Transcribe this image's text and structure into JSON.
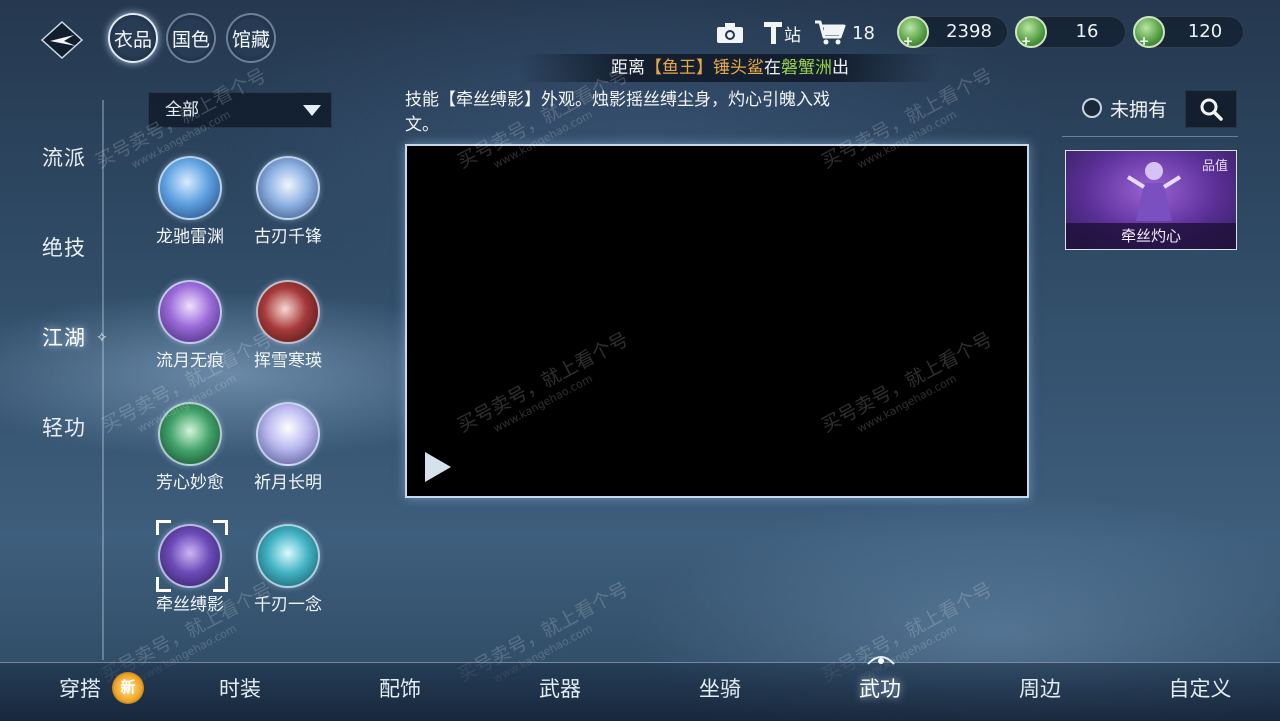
{
  "header": {
    "tabs": [
      {
        "label": "衣品",
        "active": true
      },
      {
        "label": "国色",
        "active": false
      },
      {
        "label": "馆藏",
        "active": false
      }
    ],
    "camera_icon": "camera-icon",
    "station_icon_label": "站",
    "cart_count": "18",
    "currencies": [
      {
        "name": "jade-coin-icon",
        "value": "2398"
      },
      {
        "name": "jade-coin-icon",
        "value": "16"
      },
      {
        "name": "jade-coin-icon",
        "value": "120"
      }
    ]
  },
  "notice": {
    "p1": "距离",
    "p2": "【鱼王】",
    "p3": "锤头鲨",
    "p4": "在",
    "p5": "磐蟹洲",
    "p6": "出"
  },
  "sidebar": {
    "filter": "全部",
    "tabs": [
      "流派",
      "绝技",
      "江湖",
      "轻功"
    ],
    "active_tab": "江湖"
  },
  "skills": [
    {
      "label": "龙驰雷渊"
    },
    {
      "label": "古刃千锋"
    },
    {
      "label": "流月无痕"
    },
    {
      "label": "挥雪寒瑛"
    },
    {
      "label": "芳心妙愈"
    },
    {
      "label": "祈月长明"
    },
    {
      "label": "牵丝缚影",
      "selected": true
    },
    {
      "label": "千刃一念"
    }
  ],
  "description": "技能【牵丝缚影】外观。烛影摇丝缚尘身，灼心引魄入戏文。",
  "filter_owned": {
    "label": "未拥有",
    "checked": false
  },
  "outfit_card": {
    "badge": "品值",
    "name": "牵丝灼心"
  },
  "bottom_nav": [
    {
      "label": "穿搭",
      "badge": "新"
    },
    {
      "label": "时装"
    },
    {
      "label": "配饰"
    },
    {
      "label": "武器"
    },
    {
      "label": "坐骑"
    },
    {
      "label": "武功",
      "active": true
    },
    {
      "label": "周边"
    },
    {
      "label": "自定义"
    }
  ],
  "watermark": {
    "text": "买号卖号，就上看个号",
    "url": "www.kangehao.com"
  },
  "colors": {
    "highlight_orange": "#e5a949",
    "highlight_green": "#9bd24a",
    "accent_frame": "#c6d8ea"
  }
}
